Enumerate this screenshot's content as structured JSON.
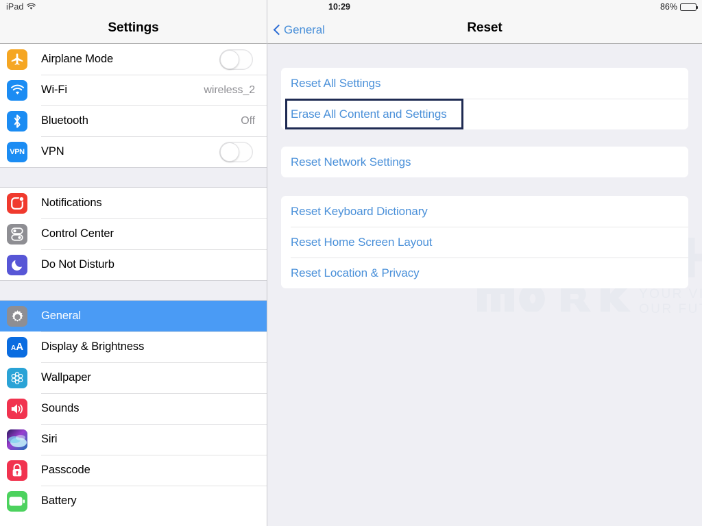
{
  "status_bar": {
    "device": "iPad",
    "wifi_icon": "wifi-icon",
    "time": "10:29",
    "battery_percent": "86%",
    "battery_level": 86
  },
  "sidebar": {
    "title": "Settings",
    "groups": [
      {
        "items": [
          {
            "label": "Airplane Mode",
            "icon": "airplane-icon",
            "icon_color": "#f5a623",
            "accessory": "toggle",
            "toggle_on": false
          },
          {
            "label": "Wi-Fi",
            "icon": "wifi-icon",
            "icon_color": "#1b8cf3",
            "accessory": "value",
            "value": "wireless_2"
          },
          {
            "label": "Bluetooth",
            "icon": "bluetooth-icon",
            "icon_color": "#1b8cf3",
            "accessory": "value",
            "value": "Off"
          },
          {
            "label": "VPN",
            "icon": "vpn-icon",
            "icon_color": "#1b8cf3",
            "accessory": "toggle",
            "toggle_on": false
          }
        ]
      },
      {
        "items": [
          {
            "label": "Notifications",
            "icon": "notifications-icon",
            "icon_color": "#f03a2e",
            "accessory": "none"
          },
          {
            "label": "Control Center",
            "icon": "control-center-icon",
            "icon_color": "#8e8e93",
            "accessory": "none"
          },
          {
            "label": "Do Not Disturb",
            "icon": "do-not-disturb-icon",
            "icon_color": "#5756d6",
            "accessory": "none"
          }
        ]
      },
      {
        "items": [
          {
            "label": "General",
            "icon": "gear-icon",
            "icon_color": "#8e8e93",
            "accessory": "none",
            "selected": true
          },
          {
            "label": "Display & Brightness",
            "icon": "display-brightness-icon",
            "icon_color": "#0a6ce0",
            "accessory": "none"
          },
          {
            "label": "Wallpaper",
            "icon": "wallpaper-icon",
            "icon_color": "#2aa3d6",
            "accessory": "none"
          },
          {
            "label": "Sounds",
            "icon": "sounds-icon",
            "icon_color": "#f1334f",
            "accessory": "none"
          },
          {
            "label": "Siri",
            "icon": "siri-icon",
            "icon_color": "#3c3b6e",
            "accessory": "none"
          },
          {
            "label": "Passcode",
            "icon": "passcode-lock-icon",
            "icon_color": "#f1334f",
            "accessory": "none"
          },
          {
            "label": "Battery",
            "icon": "battery-icon",
            "icon_color": "#4cd25e",
            "accessory": "none"
          }
        ]
      }
    ]
  },
  "detail": {
    "back_label": "General",
    "back_icon": "chevron-left-icon",
    "title": "Reset",
    "groups": [
      {
        "rows": [
          {
            "label": "Reset All Settings",
            "focused": false
          },
          {
            "label": "Erase All Content and Settings",
            "focused": true
          }
        ]
      },
      {
        "rows": [
          {
            "label": "Reset Network Settings",
            "focused": false
          }
        ]
      },
      {
        "rows": [
          {
            "label": "Reset Keyboard Dictionary",
            "focused": false
          },
          {
            "label": "Reset Home Screen Layout",
            "focused": false
          },
          {
            "label": "Reset Location & Privacy",
            "focused": false
          }
        ]
      }
    ],
    "focus_color": "#1e2a52",
    "link_color": "#4a90d9"
  },
  "watermark": {
    "line1": "HITECH",
    "line2": "WORK",
    "tagline1": "YOUR VISION",
    "tagline2": "OUR FUTURE"
  }
}
